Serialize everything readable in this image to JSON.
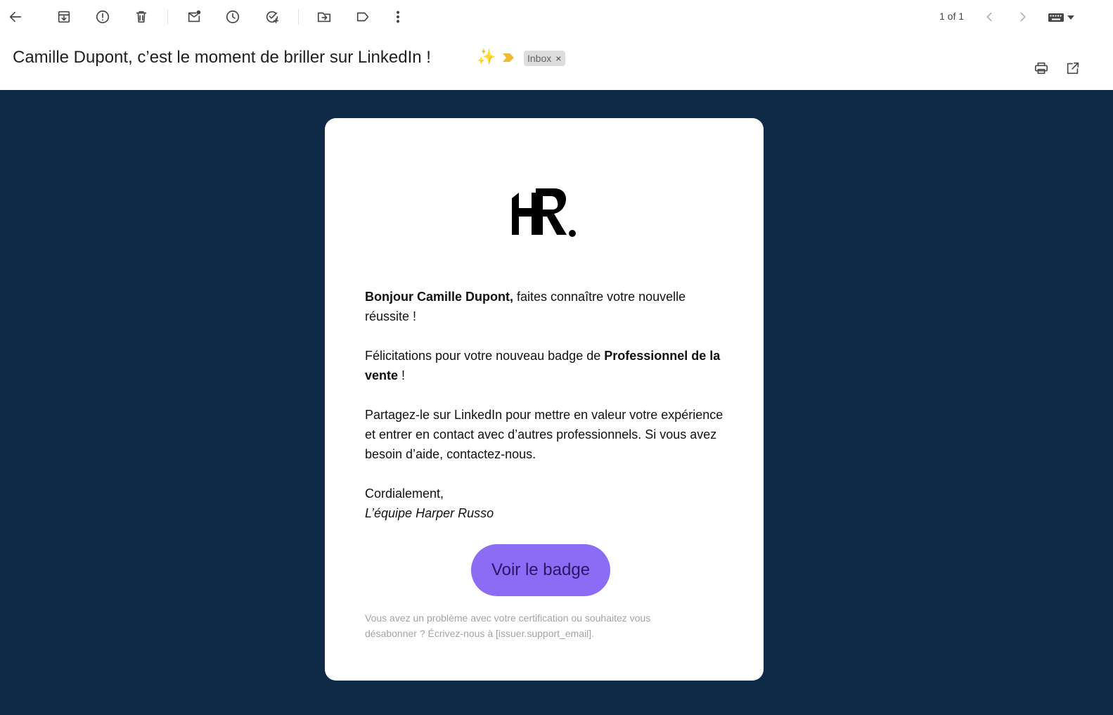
{
  "toolbar": {
    "pager": "1 of 1",
    "actions": [
      "back-icon",
      "archive-icon",
      "report-spam-icon",
      "delete-icon",
      "mark-unread-icon",
      "snooze-icon",
      "add-to-tasks-icon",
      "move-to-icon",
      "label-icon",
      "more-icon"
    ]
  },
  "email": {
    "subject": "Camille Dupont, c’est le moment de briller sur LinkedIn !",
    "subject_emoji": "✨",
    "label_chip": "Inbox",
    "chip_close": "×",
    "body": {
      "greeting_bold": "Bonjour Camille Dupont,",
      "greeting_rest": " faites connaître votre nouvelle réussite !",
      "congrats_prefix": "Félicitations pour votre nouveau badge de ",
      "badge_name": "Professionnel de la vente",
      "congrats_suffix": " !",
      "share_text": "Partagez-le sur LinkedIn pour mettre en valeur votre expérience et entrer en contact avec d’autres professionnels. Si vous avez besoin d’aide, contactez-nous.",
      "closing": "Cordialement,",
      "signature": "L’équipe Harper Russo",
      "cta_label": "Voir le badge",
      "footer_note": "Vous avez un problème avec votre certification ou souhaitez vous désabonner ? Écrivez-nous à [issuer.support_email]."
    },
    "logo_text": "HR."
  },
  "colors": {
    "email_background": "#0f2a47",
    "card_background": "#ffffff",
    "cta_background": "#8c6cf5",
    "cta_text": "#2a1766",
    "important_marker": "#f2b932"
  }
}
